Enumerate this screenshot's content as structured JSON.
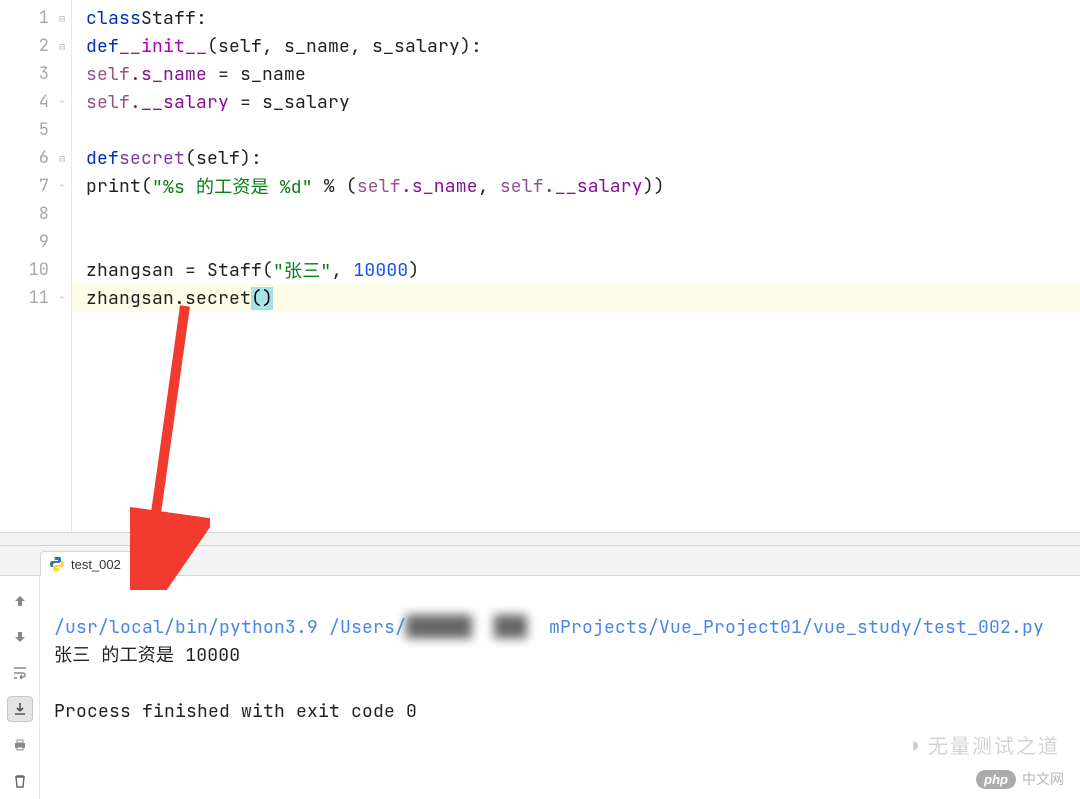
{
  "editor": {
    "lines": [
      1,
      2,
      3,
      4,
      5,
      6,
      7,
      8,
      9,
      10,
      11
    ],
    "fold_open_lines": [
      1,
      2,
      6
    ],
    "fold_close_lines": [
      4,
      7,
      11
    ],
    "highlighted_line": 11,
    "code": {
      "l1": {
        "kw": "class",
        "cls": "Staff",
        "tail": ":"
      },
      "l2": {
        "kw": "def",
        "name": "__init__",
        "args": "(self, s_name, s_salary):"
      },
      "l3": {
        "self": "self",
        "attr": ".s_name",
        "eq": " = s_name"
      },
      "l4": {
        "self": "self",
        "attr": ".__salary",
        "eq": " = s_salary"
      },
      "l6": {
        "kw": "def",
        "name": "secret",
        "args": "(self):"
      },
      "l7": {
        "fn": "print",
        "open": "(",
        "str": "\"%s 的工资是 %d\"",
        "mid": " % (",
        "self1": "self",
        "attr1": ".s_name",
        "comma": ", ",
        "self2": "self",
        "attr2": ".__salary",
        "close": "))"
      },
      "l10": {
        "var": "zhangsan = Staff(",
        "str": "\"张三\"",
        "comma": ", ",
        "num": "10000",
        "close": ")"
      },
      "l11": {
        "var": "zhangsan.secret",
        "open": "(",
        "close": ")"
      }
    }
  },
  "tab": {
    "name": "test_002"
  },
  "console": {
    "cmd_path": "/usr/local/bin/python3.9 /Users/",
    "cmd_tail": "mProjects/Vue_Project01/vue_study/test_002.py",
    "output_line": "张三 的工资是 10000",
    "exit_line": "Process finished with exit code 0"
  },
  "toolbar": {
    "buttons": [
      "up-arrow",
      "down-arrow",
      "wrap",
      "scroll-end",
      "print",
      "trash"
    ]
  },
  "watermark": {
    "icon_label": "wechat-icon",
    "text": "无量测试之道",
    "php_label": "php",
    "php_text": "中文网"
  }
}
